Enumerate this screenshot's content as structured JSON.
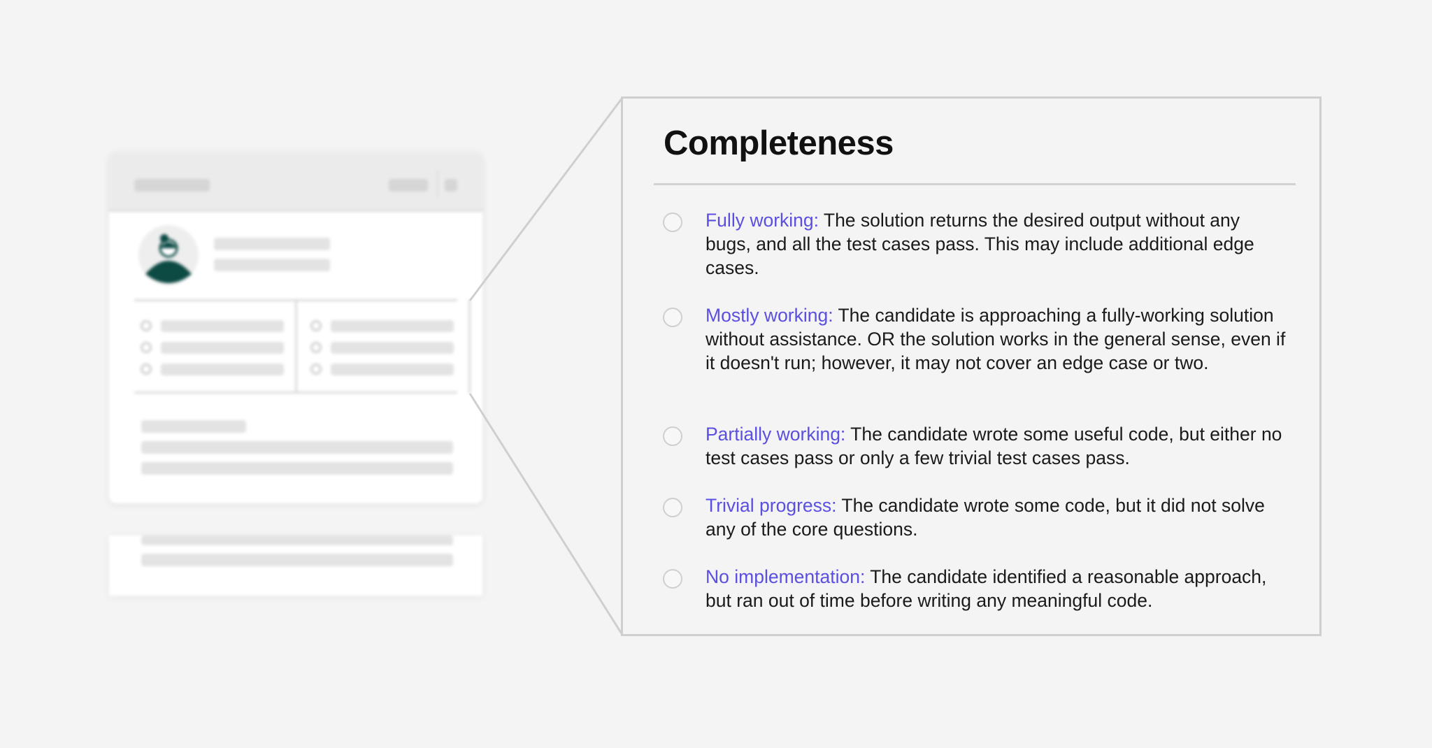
{
  "panel": {
    "title": "Completeness",
    "options": [
      {
        "label": "Fully working:",
        "description": " The solution returns the desired output without any bugs, and all the test cases pass. This may include additional edge cases."
      },
      {
        "label": "Mostly working:",
        "description": " The candidate is approaching a fully-working solution without assistance. OR the solution works in the general sense, even if it doesn't run; however, it may not cover an edge case or two."
      },
      {
        "label": "Partially working:",
        "description": " The candidate wrote some useful code, but either no test cases pass or only a few trivial test cases pass."
      },
      {
        "label": "Trivial progress:",
        "description": " The candidate wrote some code, but it did not solve any of the core questions."
      },
      {
        "label": "No implementation:",
        "description": " The candidate identified a reasonable approach, but ran out of time before writing any meaningful code."
      }
    ]
  },
  "colors": {
    "background": "#f4f4f4",
    "accent_label": "#5a4fe0",
    "avatar_accent": "#0c4a44",
    "panel_border": "#cfcfcf"
  },
  "icons": {
    "avatar": "person-avatar-icon",
    "radio": "radio-empty-icon"
  }
}
